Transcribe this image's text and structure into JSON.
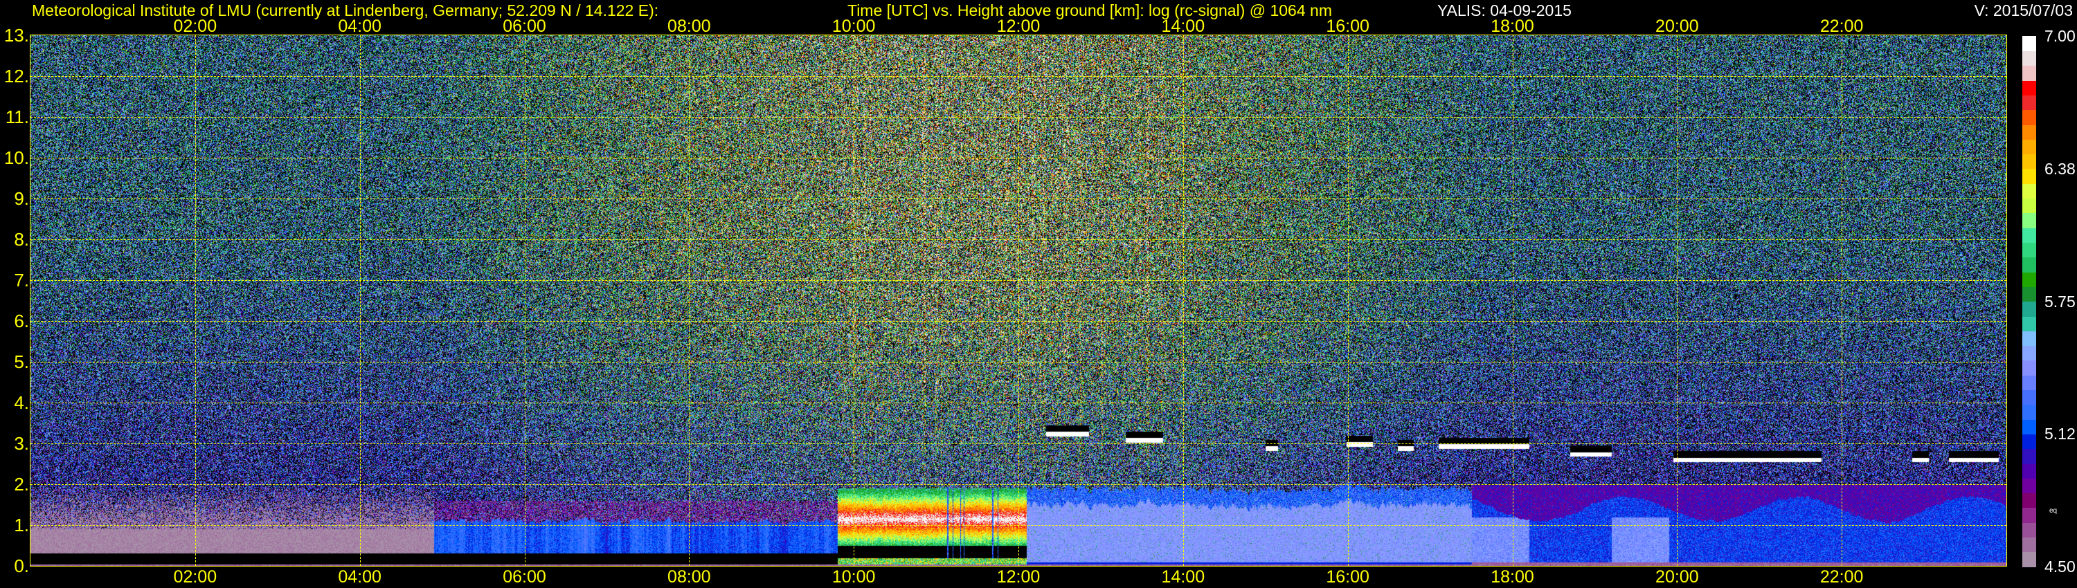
{
  "header": {
    "left_title": "Meteorological Institute of LMU (currently at Lindenberg, Germany; 52.209 N / 14.122 E):",
    "center_title": "Time [UTC] vs. Height above ground [km]: log (rc-signal) @ 1064 nm",
    "instrument": "YALIS: 04-09-2015",
    "version": "V: 2015/07/03"
  },
  "chart_data": {
    "type": "heatmap",
    "title": "Time [UTC] vs. Height above ground [km]: log (rc-signal) @ 1064 nm",
    "xlabel": "Time [UTC]",
    "ylabel": "Height above ground [km]",
    "xlim": [
      0,
      24
    ],
    "ylim": [
      0,
      13
    ],
    "grid": true,
    "x_ticks": [
      {
        "hour": 2,
        "label": "02:00"
      },
      {
        "hour": 4,
        "label": "04:00"
      },
      {
        "hour": 6,
        "label": "06:00"
      },
      {
        "hour": 8,
        "label": "08:00"
      },
      {
        "hour": 10,
        "label": "10:00"
      },
      {
        "hour": 12,
        "label": "12:00"
      },
      {
        "hour": 14,
        "label": "14:00"
      },
      {
        "hour": 16,
        "label": "16:00"
      },
      {
        "hour": 18,
        "label": "18:00"
      },
      {
        "hour": 20,
        "label": "20:00"
      },
      {
        "hour": 22,
        "label": "22:00"
      }
    ],
    "y_ticks": [
      {
        "km": 0,
        "label": "0."
      },
      {
        "km": 1,
        "label": "1."
      },
      {
        "km": 2,
        "label": "2."
      },
      {
        "km": 3,
        "label": "3."
      },
      {
        "km": 4,
        "label": "4."
      },
      {
        "km": 5,
        "label": "5."
      },
      {
        "km": 6,
        "label": "6."
      },
      {
        "km": 7,
        "label": "7."
      },
      {
        "km": 8,
        "label": "8."
      },
      {
        "km": 9,
        "label": "9."
      },
      {
        "km": 10,
        "label": "10."
      },
      {
        "km": 11,
        "label": "11."
      },
      {
        "km": 12,
        "label": "12."
      },
      {
        "km": 13,
        "label": "13."
      }
    ],
    "colorbar": {
      "range": [
        4.5,
        7.0
      ],
      "tick_labels": [
        {
          "value": 7.0,
          "label": "7.00"
        },
        {
          "value": 6.375,
          "label": "6.38"
        },
        {
          "value": 5.75,
          "label": "5.75"
        },
        {
          "value": 5.125,
          "label": "5.12"
        },
        {
          "value": 4.5,
          "label": "4.50"
        }
      ],
      "note": "eq",
      "colors_low_to_high": [
        "#a890a8",
        "#a070a0",
        "#9a5098",
        "#902890",
        "#800070",
        "#7000a0",
        "#5000b0",
        "#3010c0",
        "#0020e0",
        "#0060ff",
        "#3070ff",
        "#4870ff",
        "#6880ff",
        "#8890ff",
        "#88a8ff",
        "#80c0ff",
        "#30c8a8",
        "#20a890",
        "#189030",
        "#20a800",
        "#20c060",
        "#30d880",
        "#40e8a0",
        "#88ff80",
        "#c8ff40",
        "#e0ff40",
        "#ffe000",
        "#ffc400",
        "#ffad00",
        "#ff8a00",
        "#ff5a00",
        "#ee2a2a",
        "#ff0000",
        "#f0c4c4",
        "#ece0e0",
        "#ffffff"
      ]
    },
    "cloud_layers_km": [
      {
        "start_h": 12.33,
        "end_h": 12.85,
        "base_km": 3.25
      },
      {
        "start_h": 13.3,
        "end_h": 13.75,
        "base_km": 3.1
      },
      {
        "start_h": 15.0,
        "end_h": 15.15,
        "base_km": 2.9
      },
      {
        "start_h": 15.98,
        "end_h": 16.3,
        "base_km": 3.0
      },
      {
        "start_h": 16.6,
        "end_h": 16.8,
        "base_km": 2.9
      },
      {
        "start_h": 17.1,
        "end_h": 18.2,
        "base_km": 2.95
      },
      {
        "start_h": 18.7,
        "end_h": 19.2,
        "base_km": 2.75
      },
      {
        "start_h": 19.95,
        "end_h": 21.75,
        "base_km": 2.62
      },
      {
        "start_h": 22.85,
        "end_h": 23.05,
        "base_km": 2.62
      },
      {
        "start_h": 23.3,
        "end_h": 23.9,
        "base_km": 2.62
      }
    ]
  }
}
